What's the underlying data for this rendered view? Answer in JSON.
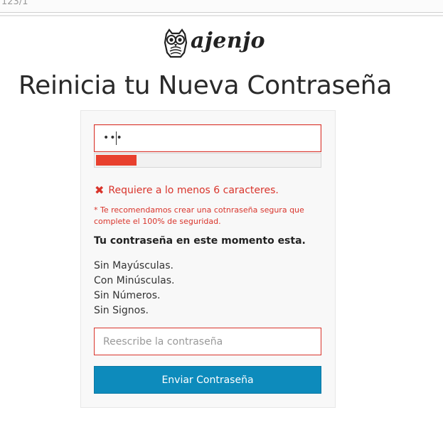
{
  "browser": {
    "url_fragment": "123/1"
  },
  "logo": {
    "icon": "owl-icon",
    "text": "ajenjo"
  },
  "page": {
    "title": "Reinicia tu Nueva Contraseña"
  },
  "form": {
    "password": {
      "value_masked": "•••"
    },
    "strength": {
      "level": 0.18,
      "color": "#e8402e"
    },
    "error": {
      "icon": "x-icon",
      "text": "Requiere a lo menos 6 caracteres."
    },
    "hint": "* Te recomendamos crear una cotnraseña segura que complete el 100% de seguridad.",
    "status_heading": "Tu contraseña en este momento esta.",
    "status_items": [
      "Sin Mayúsculas.",
      "Con Minúsculas.",
      "Sin Números.",
      "Sin Signos."
    ],
    "confirm": {
      "placeholder": "Reescribe la contraseña",
      "value": ""
    },
    "submit_label": "Enviar Contraseña"
  },
  "colors": {
    "error": "#d9342b",
    "primary": "#0d8bbc"
  }
}
